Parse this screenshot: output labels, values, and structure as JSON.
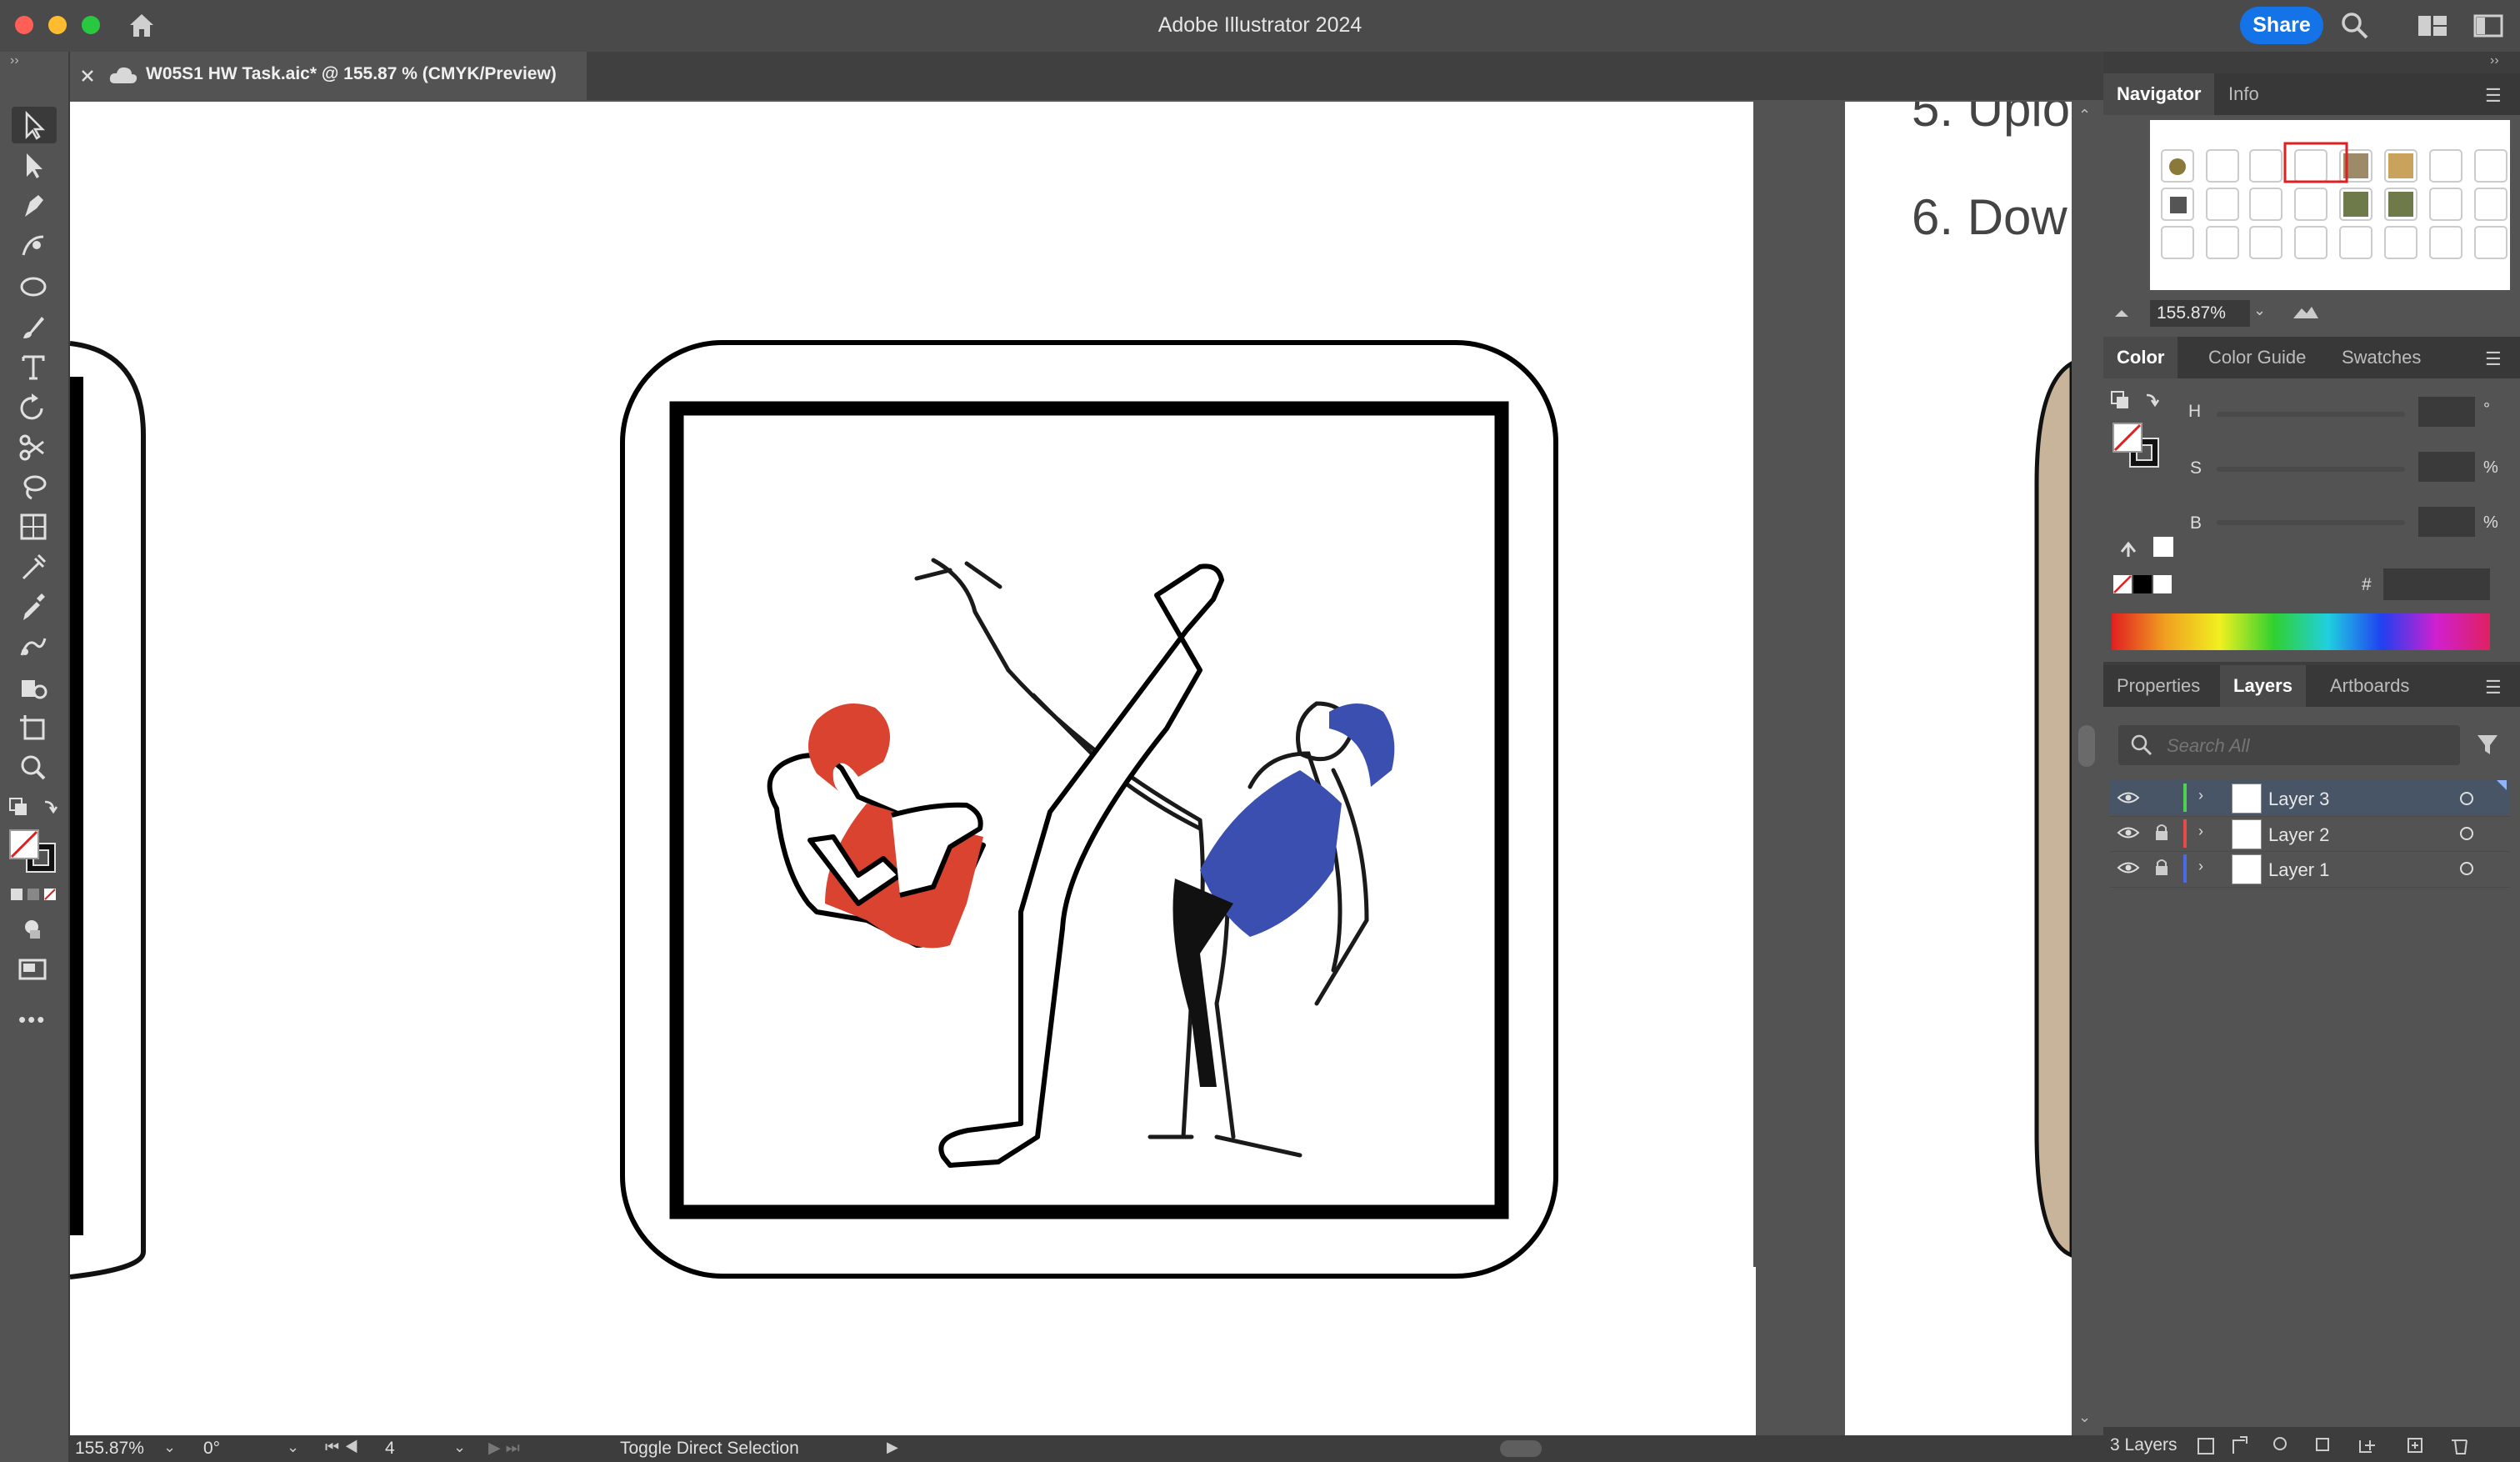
{
  "window": {
    "title": "Adobe Illustrator 2024",
    "share_label": "Share"
  },
  "document_tab": {
    "label": "W05S1 HW Task.aic* @ 155.87 % (CMYK/Preview)"
  },
  "artboard_text": {
    "line5": "5. Uplo",
    "line6": "6. Dow"
  },
  "navigator": {
    "tabs": [
      "Navigator",
      "Info"
    ],
    "zoom": "155.87%"
  },
  "color_panel": {
    "tabs": [
      "Color",
      "Color Guide",
      "Swatches"
    ],
    "h_label": "H",
    "s_label": "S",
    "b_label": "B",
    "h_unit": "°",
    "s_unit": "%",
    "b_unit": "%",
    "hex_label": "#"
  },
  "layers_panel": {
    "tabs": [
      "Properties",
      "Layers",
      "Artboards"
    ],
    "search_placeholder": "Search All",
    "layers": [
      {
        "name": "Layer 3",
        "color": "#4fd14f",
        "locked": false,
        "selected": true
      },
      {
        "name": "Layer 2",
        "color": "#e84a4a",
        "locked": true,
        "selected": false
      },
      {
        "name": "Layer 1",
        "color": "#4a6be8",
        "locked": true,
        "selected": false
      }
    ],
    "count_label": "3 Layers"
  },
  "statusbar": {
    "zoom": "155.87%",
    "rotation": "0°",
    "artboard_number": "4",
    "tool_hint": "Toggle Direct Selection"
  },
  "colors": {
    "accent": "#1473e6",
    "fighter_left": "#d9432f",
    "fighter_right": "#3b4fb0"
  }
}
